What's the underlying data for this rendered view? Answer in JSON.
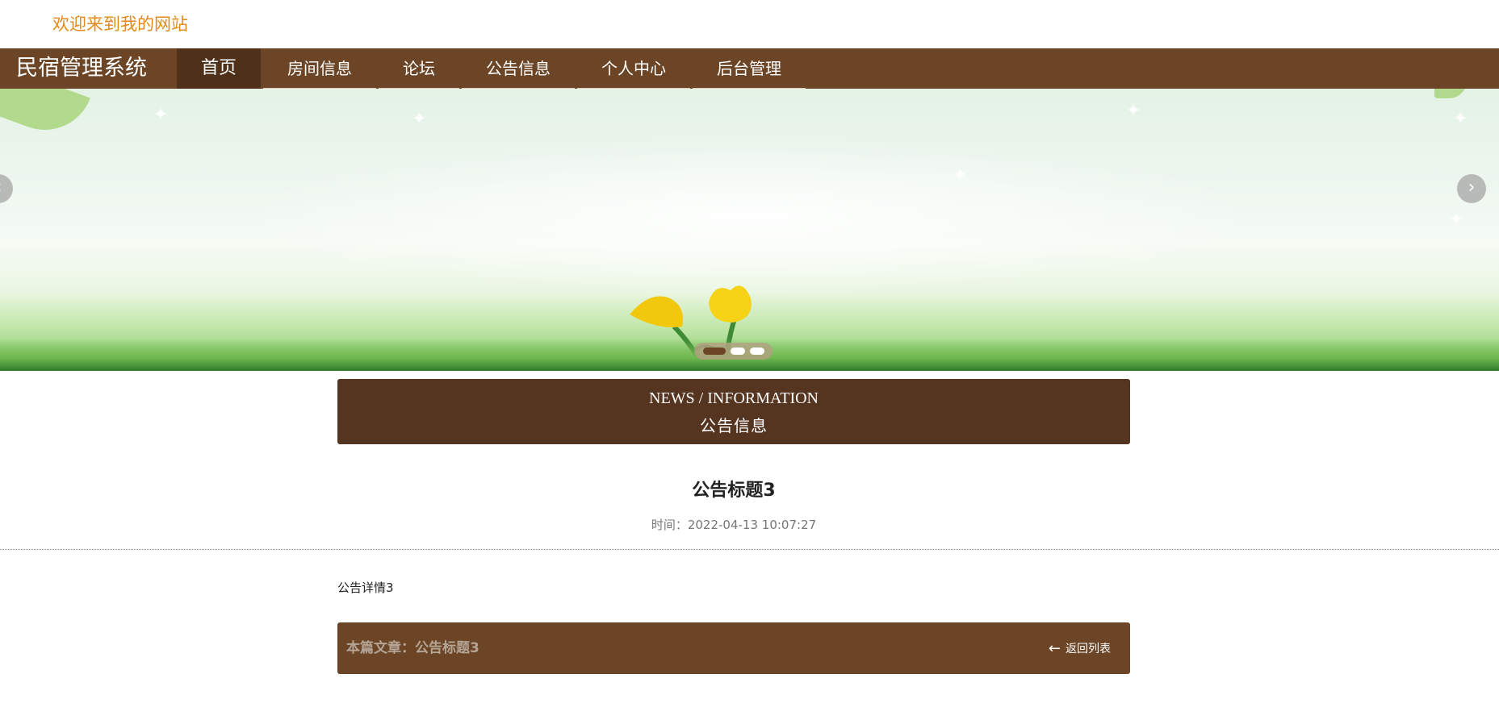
{
  "header": {
    "welcome_text": "欢迎来到我的网站"
  },
  "nav": {
    "brand": "民宿管理系统",
    "items": [
      {
        "label": "首页",
        "active": true
      },
      {
        "label": "房间信息"
      },
      {
        "label": "论坛"
      },
      {
        "label": "公告信息"
      },
      {
        "label": "个人中心"
      },
      {
        "label": "后台管理"
      }
    ]
  },
  "carousel": {
    "prev_icon": "‹",
    "next_icon": "›",
    "slide_count": 3,
    "active_index": 0
  },
  "section": {
    "title_en": "NEWS / INFORMATION",
    "title_cn": "公告信息"
  },
  "article": {
    "title": "公告标题3",
    "time": "时间：2022-04-13 10:07:27",
    "body": "公告详情3"
  },
  "footer_bar": {
    "current_label": "本篇文章：公告标题3",
    "back_label": "返回列表",
    "back_icon": "arrow-left-icon"
  },
  "colors": {
    "nav_bg": "#6b4526",
    "nav_active": "#4f3018",
    "section_bg": "#553420",
    "welcome": "#e38a1e"
  }
}
